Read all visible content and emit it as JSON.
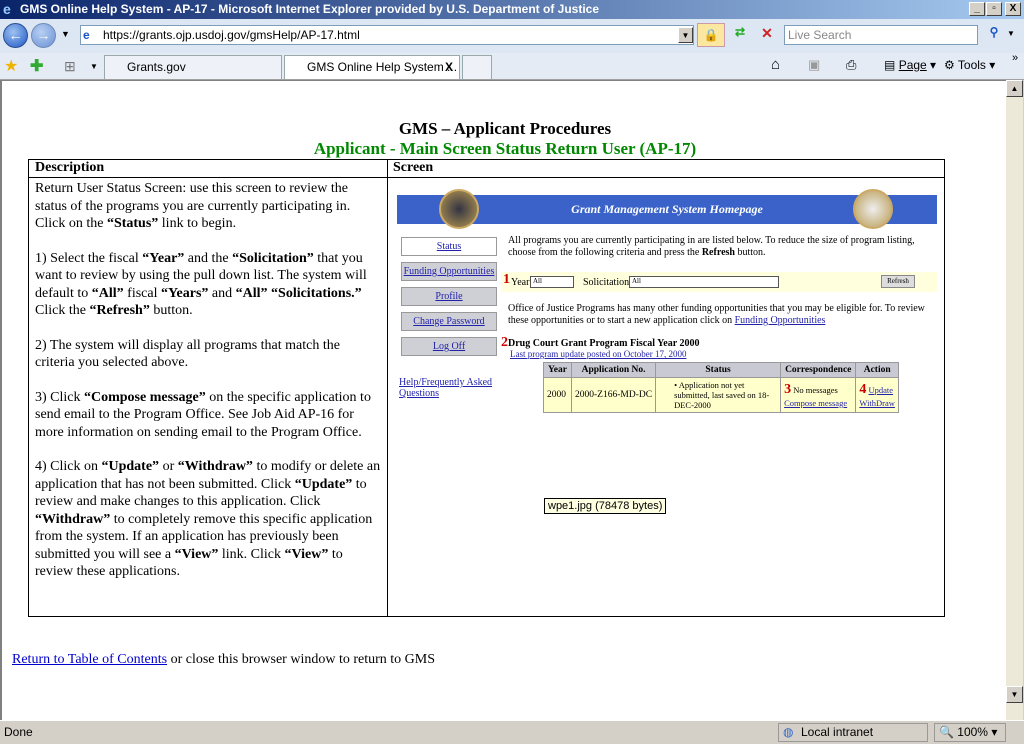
{
  "window": {
    "title": "GMS Online Help System - AP-17 - Microsoft Internet Explorer provided by U.S. Department of Justice",
    "min": "_",
    "max": "▫",
    "close": "X"
  },
  "browser": {
    "url": "https://grants.ojp.usdoj.gov/gmsHelp/AP-17.html",
    "search_placeholder": "Live Search",
    "tabs": [
      {
        "label": "Grants.gov"
      },
      {
        "label": "GMS Online Help System ...",
        "close": "X"
      }
    ],
    "tools": {
      "page": "Page",
      "tools": "Tools"
    }
  },
  "page": {
    "title": "GMS – Applicant Procedures",
    "subtitle": "Applicant - Main Screen Status Return User (AP-17)",
    "col_description": "Description",
    "col_screen": "Screen",
    "paragraphs": [
      [
        {
          "t": "Return User Status Screen: use this screen to review the status of the programs you are currently participating in.  Click on the "
        },
        {
          "b": "“Status”"
        },
        {
          "t": " link to begin."
        }
      ],
      [
        {
          "t": "1) Select the fiscal "
        },
        {
          "b": "“Year”"
        },
        {
          "t": " and the "
        },
        {
          "b": "“Solicitation”"
        },
        {
          "t": " that you want to review by using the pull down list.  The system will default to "
        },
        {
          "b": "“All”"
        },
        {
          "t": " fiscal "
        },
        {
          "b": "“Years”"
        },
        {
          "t": " and "
        },
        {
          "b": "“All” “Solicitations.”"
        },
        {
          "t": "  Click the "
        },
        {
          "b": "“Refresh”"
        },
        {
          "t": " button."
        }
      ],
      [
        {
          "t": "2) The system will display all programs that match the criteria you selected above."
        }
      ],
      [
        {
          "t": "3) Click "
        },
        {
          "b": "“Compose message”"
        },
        {
          "t": " on the specific application to send email to the Program Office. See Job Aid AP-16 for more information on sending email to the Program Office."
        }
      ],
      [
        {
          "t": "4) Click on "
        },
        {
          "b": "“Update”"
        },
        {
          "t": " or "
        },
        {
          "b": "“Withdraw”"
        },
        {
          "t": " to modify or delete an application that has not been submitted.  Click "
        },
        {
          "b": "“Update”"
        },
        {
          "t": " to review and make changes to this application.  Click "
        },
        {
          "b": "“Withdraw”"
        },
        {
          "t": " to completely remove this specific application from the system. If an application has previously been submitted you will see a "
        },
        {
          "b": "“View”"
        },
        {
          "t": " link.  Click "
        },
        {
          "b": "“View”"
        },
        {
          "t": " to review these applications."
        }
      ]
    ],
    "footer_link": "Return to Table of Contents",
    "footer_text": " or close this browser window to return to GMS",
    "tooltip": "wpe1.jpg (78478 bytes)"
  },
  "screenshot": {
    "banner": "Grant Management System Homepage",
    "nav": [
      "Status",
      "Funding Opportunities",
      "Profile",
      "Change Password",
      "Log Off"
    ],
    "help": "Help/Frequently Asked Questions",
    "intro": "All programs you are currently participating in are listed below.  To reduce the size of program listing, choose from the following criteria and press the ",
    "intro_bold": "Refresh",
    "intro_end": " button.",
    "year_label": "Year",
    "year_value": "All",
    "solicitation_label": "Solicitation",
    "solicitation_value": "All",
    "refresh": "Refresh",
    "office_text": "Office of Justice Programs has many other funding opportunities that you may be eligible for.  To review these opportunities or to start a new application click on ",
    "office_link": "Funding Opportunities",
    "program": "Drug Court Grant Program Fiscal Year 2000",
    "last_update": "Last program update posted on October 17, 2000",
    "headers": [
      "Year",
      "Application No.",
      "Status",
      "Correspondence",
      "Action"
    ],
    "row": {
      "year": "2000",
      "app_no": "2000-Z166-MD-DC",
      "status": "Application not yet submitted, last saved on 18-DEC-2000",
      "no_messages": "No messages",
      "compose": "Compose message",
      "update": "Update",
      "withdraw": "WithDraw"
    },
    "markers": [
      "1",
      "2",
      "3",
      "4"
    ]
  },
  "statusbar": {
    "text": "Done",
    "zone": "Local intranet",
    "zoom": "100%"
  }
}
